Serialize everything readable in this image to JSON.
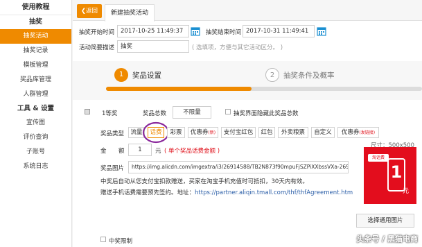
{
  "sidebar": {
    "title": "使用教程",
    "groups": [
      {
        "label": "抽奖",
        "items": [
          "抽奖活动",
          "抽奖记录",
          "模板管理",
          "奖品库管理",
          "人群管理"
        ]
      },
      {
        "label": "工具 & 设置",
        "items": [
          "宣传图",
          "评价查询",
          "子账号",
          "系统日志"
        ]
      }
    ]
  },
  "tabs": {
    "back_label": "返回",
    "active_tab": "新建抽奖活动"
  },
  "form": {
    "start_label": "抽奖开始时间",
    "start_value": "2017-10-25 11:49:37",
    "end_label": "抽奖结束时间",
    "end_value": "2017-10-31 11:49:41",
    "desc_label": "活动简要描述",
    "desc_value": "抽奖",
    "desc_hint": "( 选填项，方便与其它活动区分。 )"
  },
  "steps": [
    {
      "num": "1",
      "label": "奖品设置"
    },
    {
      "num": "2",
      "label": "抽奖条件及概率"
    }
  ],
  "progress_fraction": 0.46,
  "prize": {
    "rank": "1等奖",
    "total_label": "奖品总数",
    "total_value": "不限量",
    "hide_label": "抽奖界面隐藏此奖品总数",
    "type_label": "奖品类型",
    "types": [
      {
        "label": "流量",
        "sup": ""
      },
      {
        "label": "话费",
        "sup": ""
      },
      {
        "label": "彩票",
        "sup": ""
      },
      {
        "label": "优惠券",
        "sup": "(新)"
      },
      {
        "label": "支付宝红包",
        "sup": ""
      },
      {
        "label": "红包",
        "sup": ""
      },
      {
        "label": "外卖粮票",
        "sup": ""
      },
      {
        "label": "自定义",
        "sup": ""
      },
      {
        "label": "优惠券",
        "sup": "(发链接)"
      }
    ],
    "selected_type": "话费",
    "amount_label_1": "金",
    "amount_label_2": "额",
    "amount_value": "1",
    "amount_unit": "元",
    "amount_note": "( 单个奖品话费金额 )",
    "size_note": "尺寸：500x500",
    "image_label": "奖品图片",
    "image_url": "https://img.alicdn.com/imgextra/i3/26914588/TB2N873f90mpuFjSZPiXXbssVXa-26914588.gif",
    "desc_line1": "中奖后自动从您支付宝扣款赠送，买家在淘宝手机充值时可抵扣，30天内有效。",
    "desc_line2_prefix": "赠送手机话费需要预先签约。地址：",
    "desc_line2_link": "https://partner.aliqin.tmall.com/thf/thfAgreement.htm",
    "choose_image_button": "选择通用图片",
    "limit_label": "中奖限制",
    "badge_title": "淘话费",
    "badge_value": "1",
    "badge_unit": "元"
  },
  "watermark": "头条号 / 黑猫电商",
  "colors": {
    "accent": "#ef8a00",
    "link": "#2c5fa8",
    "badge_red": "#e30d1d",
    "highlight_circle": "#8b2a9c"
  }
}
